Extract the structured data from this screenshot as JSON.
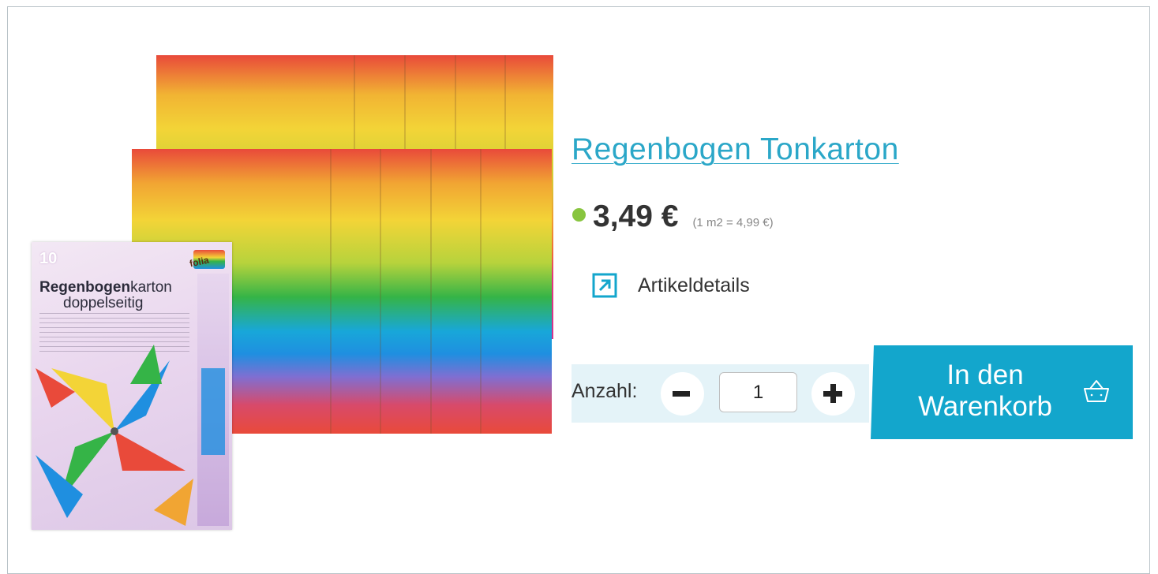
{
  "product": {
    "title": "Regenbogen Tonkarton",
    "price": "3,49 €",
    "unit_price": "(1 m2 = 4,99 €)",
    "stock_color": "#88c53f",
    "details_label": "Artikeldetails",
    "details_icon": "external-link-icon"
  },
  "image": {
    "pack_count": "10",
    "pack_brand": "folia",
    "pack_title_bold": "Regenbogen",
    "pack_title_rest": "karton",
    "pack_subtitle": "doppelseitig"
  },
  "quantity": {
    "label": "Anzahl:",
    "value": "1",
    "minus_icon": "minus-icon",
    "plus_icon": "plus-icon"
  },
  "cart": {
    "label": "In den\nWarenkorb",
    "icon": "basket-icon",
    "color": "#13a6cc"
  },
  "theme": {
    "accent": "#2ba7c8",
    "qty_background": "#e4f3f8"
  }
}
